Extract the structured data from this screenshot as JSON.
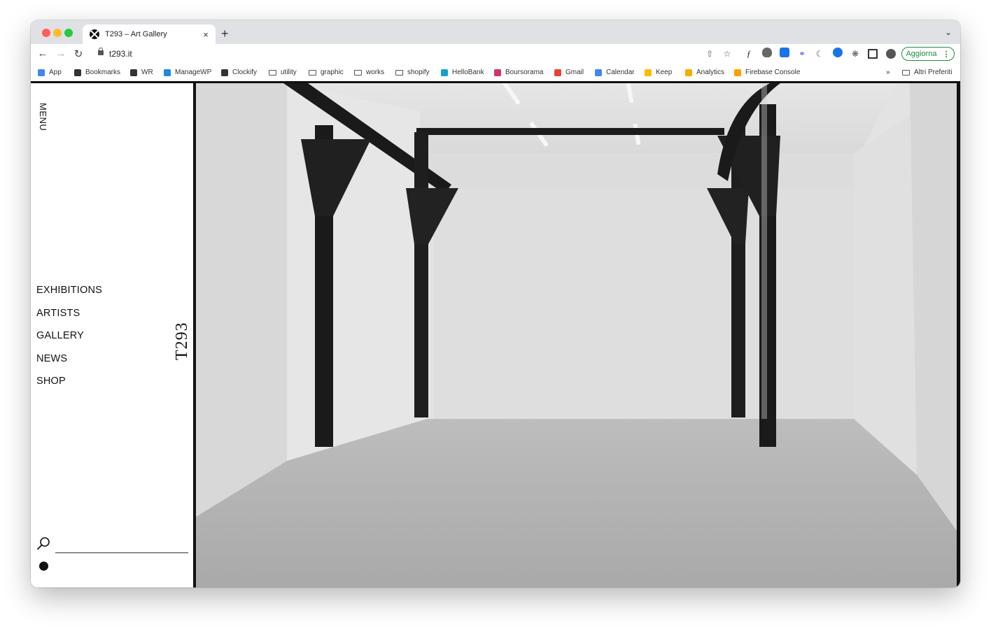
{
  "browser": {
    "tab_title": "T293 – Art Gallery",
    "tab_close": "×",
    "new_tab": "+",
    "tab_menu": "⌄",
    "url": "t293.it",
    "update_label": "Aggiorna",
    "update_menu": "⋮",
    "bookmarks": [
      {
        "label": "App",
        "color": "#4285f4"
      },
      {
        "label": "Bookmarks",
        "color": "#333333"
      },
      {
        "label": "WR",
        "color": "#333333"
      },
      {
        "label": "ManageWP",
        "color": "#1e88e5"
      },
      {
        "label": "Clockify",
        "color": "#333333"
      },
      {
        "label": "utility",
        "folder": true
      },
      {
        "label": "graphic",
        "folder": true
      },
      {
        "label": "works",
        "folder": true
      },
      {
        "label": "shopify",
        "folder": true
      },
      {
        "label": "HelloBank",
        "color": "#14a0c8"
      },
      {
        "label": "Boursorama",
        "color": "#d6336c"
      },
      {
        "label": "Gmail",
        "color": "#ea4335"
      },
      {
        "label": "Calendar",
        "color": "#4285f4"
      },
      {
        "label": "Keep",
        "color": "#fbbc04"
      },
      {
        "label": "Analytics",
        "color": "#f9ab00"
      },
      {
        "label": "Firebase Console",
        "color": "#ffa000"
      }
    ],
    "bookmarks_overflow": "»",
    "other_bookmarks": "Altri Preferiti"
  },
  "site": {
    "menu_label": "MENU",
    "nav": [
      "EXHIBITIONS",
      "ARTISTS",
      "GALLERY",
      "NEWS",
      "SHOP"
    ],
    "logo": "T293",
    "search_placeholder": ""
  }
}
